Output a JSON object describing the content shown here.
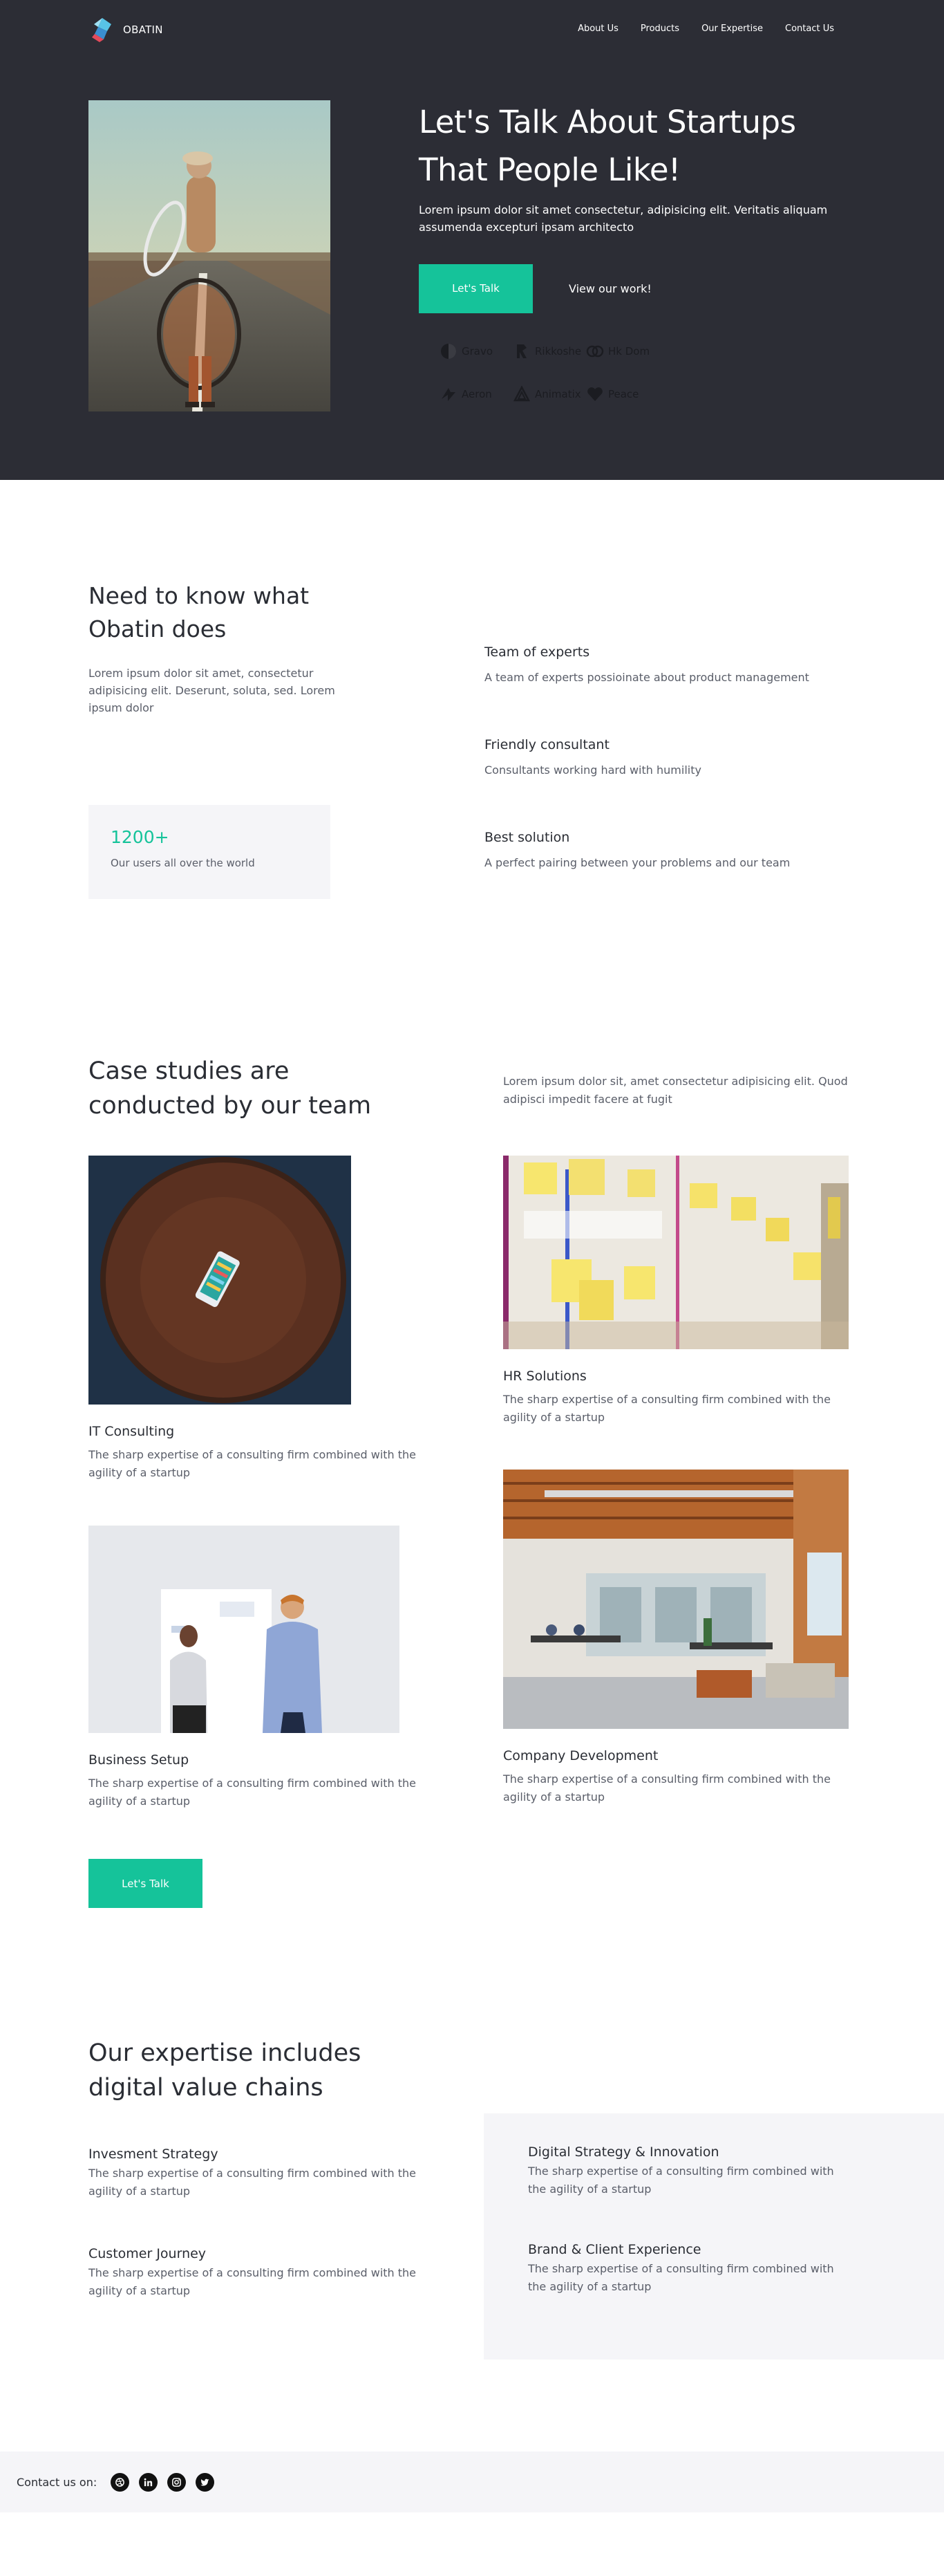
{
  "nav": {
    "brand": "OBATIN",
    "links": [
      "About Us",
      "Products",
      "Our Expertise",
      "Contact Us"
    ]
  },
  "hero": {
    "title_line1": "Let's Talk About Startups",
    "title_line2": "That People Like!",
    "text": "Lorem ipsum dolor sit amet consectetur, adipisicing elit. Veritatis aliquam assumenda excepturi ipsam architecto",
    "primary_button": "Let's Talk",
    "secondary_button": "View our work!",
    "clients": [
      {
        "name": "Gravo",
        "icon": "gravo-icon"
      },
      {
        "name": "Rikkoshe",
        "icon": "rikkoshe-icon"
      },
      {
        "name": "Hk Dom",
        "icon": "hkdom-icon"
      },
      {
        "name": "Aeron",
        "icon": "aeron-icon"
      },
      {
        "name": "Animatix",
        "icon": "animatix-icon"
      },
      {
        "name": "Peace",
        "icon": "heart-icon"
      }
    ]
  },
  "about": {
    "title_line1": "Need to know what",
    "title_line2": "Obatin does",
    "text": "Lorem ipsum dolor sit amet, consectetur adipisicing elit. Deserunt, soluta, sed. Lorem ipsum dolor",
    "stat_value": "1200+",
    "stat_label": "Our users all over the world",
    "features": [
      {
        "title": "Team of experts",
        "text": "A team of experts possioinate about product management"
      },
      {
        "title": "Friendly consultant",
        "text": "Consultants working hard with humility"
      },
      {
        "title": "Best solution",
        "text": "A perfect pairing between your problems and our team"
      }
    ]
  },
  "cases": {
    "title_line1": "Case studies are",
    "title_line2": "conducted by our team",
    "intro": "Lorem ipsum dolor sit, amet consectetur adipisicing elit. Quod adipisci impedit facere at fugit",
    "items": [
      {
        "title": "IT Consulting",
        "text": "The sharp expertise of a consulting firm combined with the agility of a startup"
      },
      {
        "title": "HR Solutions",
        "text": "The sharp expertise of a consulting firm combined with the agility of a startup"
      },
      {
        "title": "Business Setup",
        "text": "The sharp expertise of a consulting firm combined with the agility of a startup"
      },
      {
        "title": "Company Development",
        "text": "The sharp expertise of a consulting firm combined with the agility of a startup"
      }
    ],
    "cta": "Let's Talk"
  },
  "expertise": {
    "title_line1": "Our expertise includes",
    "title_line2": "digital value chains",
    "items": [
      {
        "title": "Invesment Strategy",
        "text": "The sharp expertise of a consulting firm combined with the agility of a startup"
      },
      {
        "title": "Customer Journey",
        "text": "The sharp expertise of a consulting firm combined with the agility of a startup"
      },
      {
        "title": "Digital Strategy & Innovation",
        "text": "The sharp expertise of a consulting firm combined with the agility of a startup"
      },
      {
        "title": "Brand & Client Experience",
        "text": "The sharp expertise of a consulting firm combined with the agility of a startup"
      }
    ]
  },
  "footer": {
    "label": "Contact us on:",
    "socials": [
      "dribbble-icon",
      "linkedin-icon",
      "instagram-icon",
      "twitter-icon"
    ]
  },
  "colors": {
    "accent": "#15c39a",
    "hero_bg": "#2c2d35",
    "panel_bg": "#f5f5f8",
    "heading": "#2a2d34",
    "body_text": "#5a5e69"
  }
}
